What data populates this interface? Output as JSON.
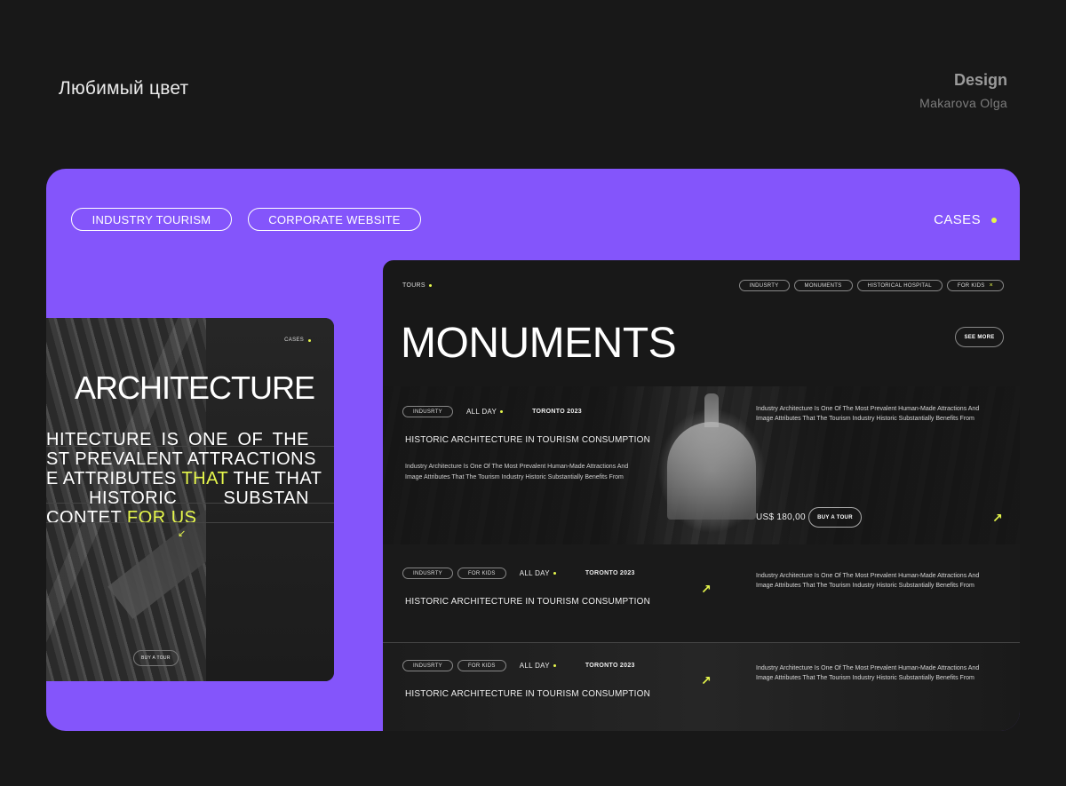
{
  "header": {
    "title": "Любимый цвет",
    "role": "Design",
    "author": "Makarova Olga"
  },
  "showcase": {
    "accent_color": "#8455fb",
    "highlight_color": "#e6f74c",
    "pills": [
      "INDUSTRY TOURISM",
      "CORPORATE WEBSITE"
    ],
    "cases_label": "CASES"
  },
  "left_card": {
    "cases_label": "CASES",
    "title": "ARCHITECTURE",
    "lines": [
      {
        "text": "HITECTURE IS ONE OF THE",
        "highlight": ""
      },
      {
        "text": "ST PREVALENT ATTRACTIONS",
        "highlight": ""
      },
      {
        "text_before": "E ATTRIBUTES ",
        "highlight": "THAT",
        "text_after": " THE THAT"
      },
      {
        "text": "HISTORIC SUBSTAN",
        "highlight": ""
      },
      {
        "text_before": "CONTET ",
        "highlight": "FOR US",
        "text_after": ""
      }
    ],
    "arrow_icon": "arrow-down-left-icon",
    "buy_label": "BUY A TOUR"
  },
  "right_card": {
    "tours_label": "TOURS",
    "filter_tags": [
      "INDUSRTY",
      "MONUMENTS",
      "HISTORICAL HOSPITAL",
      "FOR KIDS"
    ],
    "close_icon": "×",
    "title": "MONUMENTS",
    "see_more": "SEE MORE",
    "rows": [
      {
        "tags": [
          "INDUSRTY"
        ],
        "all_day": "ALL DAY",
        "city": "TORONTO 2023",
        "heading": "HISTORIC ARCHITECTURE IN TOURISM CONSUMPTION",
        "description": "Industry Architecture Is One Of The Most Prevalent Human-Made Attractions And Image Attributes That The Tourism Industry Historic Substantially Benefits From",
        "right_description": "Industry Architecture Is One Of The Most Prevalent Human-Made Attractions And Image Attributes That The Tourism Industry Historic Substantially Benefits From",
        "price": "US$ 180,00",
        "buy_label": "BUY A TOUR"
      },
      {
        "tags": [
          "INDUSRTY",
          "FOR KIDS"
        ],
        "all_day": "ALL DAY",
        "city": "TORONTO 2023",
        "heading": "HISTORIC ARCHITECTURE IN TOURISM CONSUMPTION",
        "right_description": "Industry Architecture Is One Of The Most Prevalent Human-Made Attractions And Image Attributes That The Tourism Industry Historic Substantially Benefits From"
      },
      {
        "tags": [
          "INDUSRTY",
          "FOR KIDS"
        ],
        "all_day": "ALL DAY",
        "city": "TORONTO 2023",
        "heading": "HISTORIC ARCHITECTURE IN TOURISM CONSUMPTION",
        "right_description": "Industry Architecture Is One Of The Most Prevalent Human-Made Attractions And Image Attributes That The Tourism Industry Historic Substantially Benefits From"
      }
    ]
  }
}
